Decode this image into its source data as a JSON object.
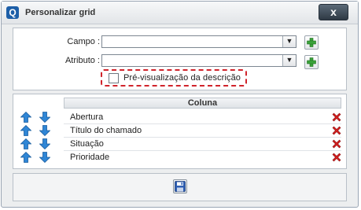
{
  "window": {
    "title": "Personalizar grid",
    "logo_letter": "Q",
    "close_label": "x"
  },
  "form": {
    "campo_label": "Campo :",
    "atributo_label": "Atributo :",
    "campo_value": "",
    "atributo_value": "",
    "preview_label": "Pré-visualização da descrição",
    "preview_checked": false
  },
  "grid": {
    "header": "Coluna",
    "rows": [
      {
        "label": "Abertura"
      },
      {
        "label": "Título do chamado"
      },
      {
        "label": "Situação"
      },
      {
        "label": "Prioridade"
      }
    ]
  },
  "icons": {
    "close": "close-icon",
    "add": "plus-icon",
    "move_up": "arrow-up-icon",
    "move_down": "arrow-down-icon",
    "delete": "delete-x-icon",
    "save": "floppy-disk-icon",
    "select_arrow": "chevron-down-icon"
  },
  "colors": {
    "accent": "#1d5fa8",
    "arrow": "#2f86d6",
    "delete": "#d62020",
    "add": "#3aa33a",
    "highlight_dashed": "#d0242b"
  }
}
